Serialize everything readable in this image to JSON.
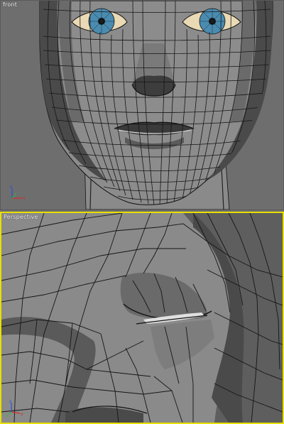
{
  "viewports": {
    "front": {
      "label": "front",
      "active": false,
      "axes": {
        "x": "x",
        "y": "y",
        "z": "z"
      }
    },
    "perspective": {
      "label": "Perspective",
      "active": true,
      "axes": {
        "x": "x",
        "y": "y",
        "z": "z"
      }
    }
  },
  "colors": {
    "viewport_bg": "#6e6e6e",
    "active_border": "#e8e000",
    "wire": "#111111",
    "iris": "#4a8bb0",
    "sclera": "#e9d9b4",
    "axis_x": "#d42a2a",
    "axis_y": "#2dbd2d",
    "axis_z": "#2b4fd6"
  }
}
